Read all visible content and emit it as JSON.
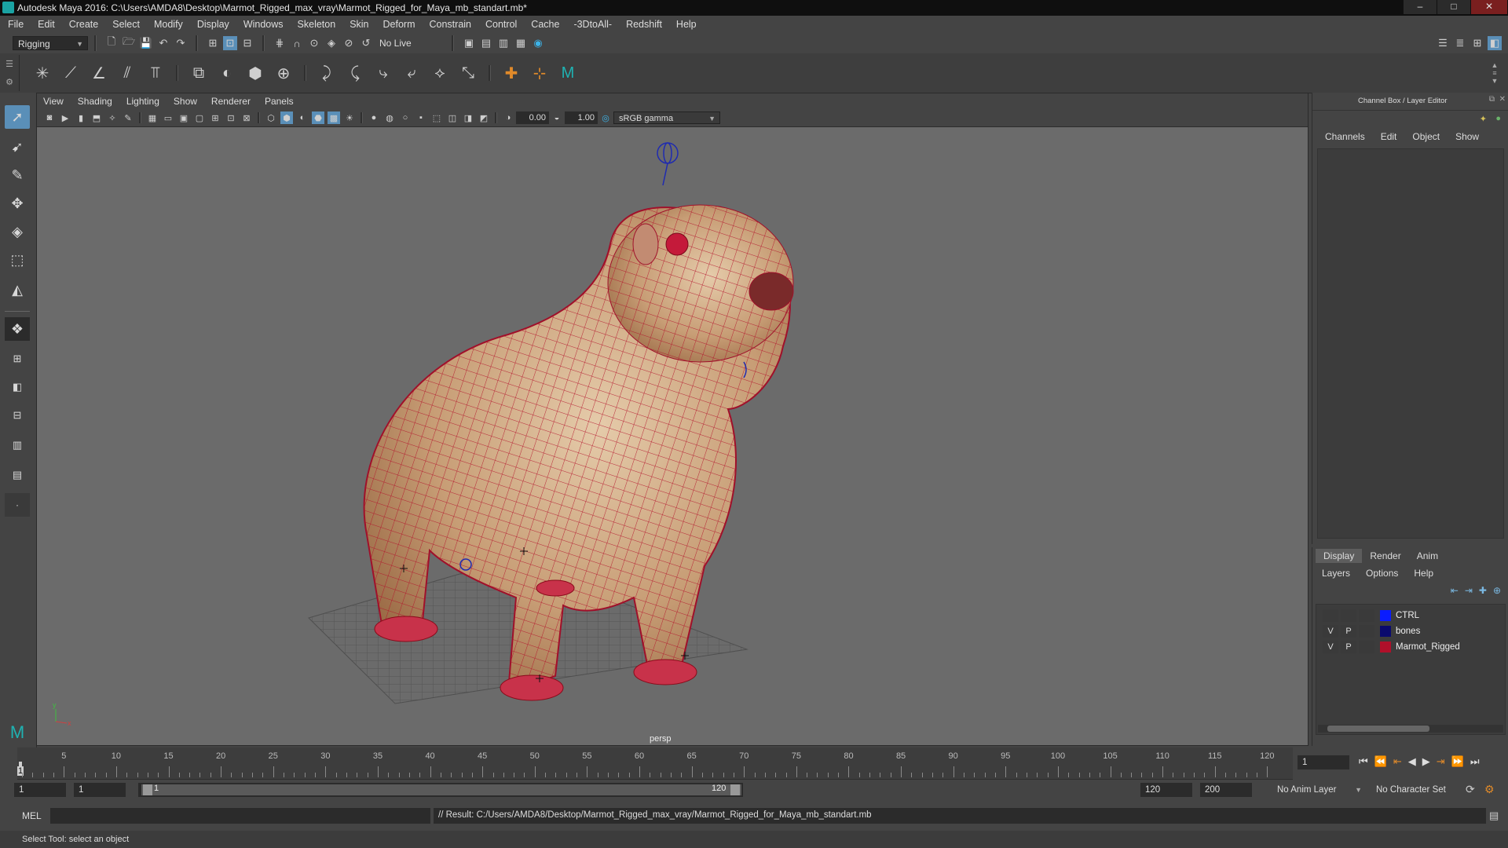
{
  "window": {
    "title": "Autodesk Maya 2016: C:\\Users\\AMDA8\\Desktop\\Marmot_Rigged_max_vray\\Marmot_Rigged_for_Maya_mb_standart.mb*",
    "minimize": "–",
    "maximize": "□",
    "close": "✕"
  },
  "menu": [
    "File",
    "Edit",
    "Create",
    "Select",
    "Modify",
    "Display",
    "Windows",
    "Skeleton",
    "Skin",
    "Deform",
    "Constrain",
    "Control",
    "Cache",
    "-3DtoAll-",
    "Redshift",
    "Help"
  ],
  "status_line": {
    "menu_set": "Rigging",
    "live_surface": "No Live Surface"
  },
  "viewport": {
    "menu": [
      "View",
      "Shading",
      "Lighting",
      "Show",
      "Renderer",
      "Panels"
    ],
    "exposure": "0.00",
    "gamma": "1.00",
    "color_space": "sRGB gamma",
    "panel_name": "persp",
    "axis_y": "y",
    "axis_x": "x"
  },
  "channel_box": {
    "title": "Channel Box / Layer Editor",
    "menu": [
      "Channels",
      "Edit",
      "Object",
      "Show"
    ]
  },
  "layer_editor": {
    "tabs": [
      "Display",
      "Render",
      "Anim"
    ],
    "active_tab": "Display",
    "menu": [
      "Layers",
      "Options",
      "Help"
    ],
    "layers": [
      {
        "v": "",
        "p": "",
        "name": "CTRL",
        "color": "#0a1cff"
      },
      {
        "v": "V",
        "p": "P",
        "name": "bones",
        "color": "#0a0a6e"
      },
      {
        "v": "V",
        "p": "P",
        "name": "Marmot_Rigged",
        "color": "#b0102a"
      }
    ]
  },
  "time_slider": {
    "ticks": [
      "5",
      "10",
      "15",
      "20",
      "25",
      "30",
      "35",
      "40",
      "45",
      "50",
      "55",
      "60",
      "65",
      "70",
      "75",
      "80",
      "85",
      "90",
      "95",
      "100",
      "105",
      "110",
      "115",
      "120"
    ],
    "current_frame_marker": "1",
    "current_frame": "1"
  },
  "range_slider": {
    "start": "1",
    "playback_start": "1",
    "range_start_label": "1",
    "range_end_label": "120",
    "playback_end": "120",
    "end": "200",
    "anim_layer": "No Anim Layer",
    "character_set": "No Character Set"
  },
  "command_line": {
    "language": "MEL",
    "result": "// Result: C:/Users/AMDA8/Desktop/Marmot_Rigged_max_vray/Marmot_Rigged_for_Maya_mb_standart.mb"
  },
  "help_line": "Select Tool: select an object",
  "colors": {
    "accent": "#5a8fb8",
    "wire": "#c0102a",
    "fur": "#c9a07a"
  }
}
